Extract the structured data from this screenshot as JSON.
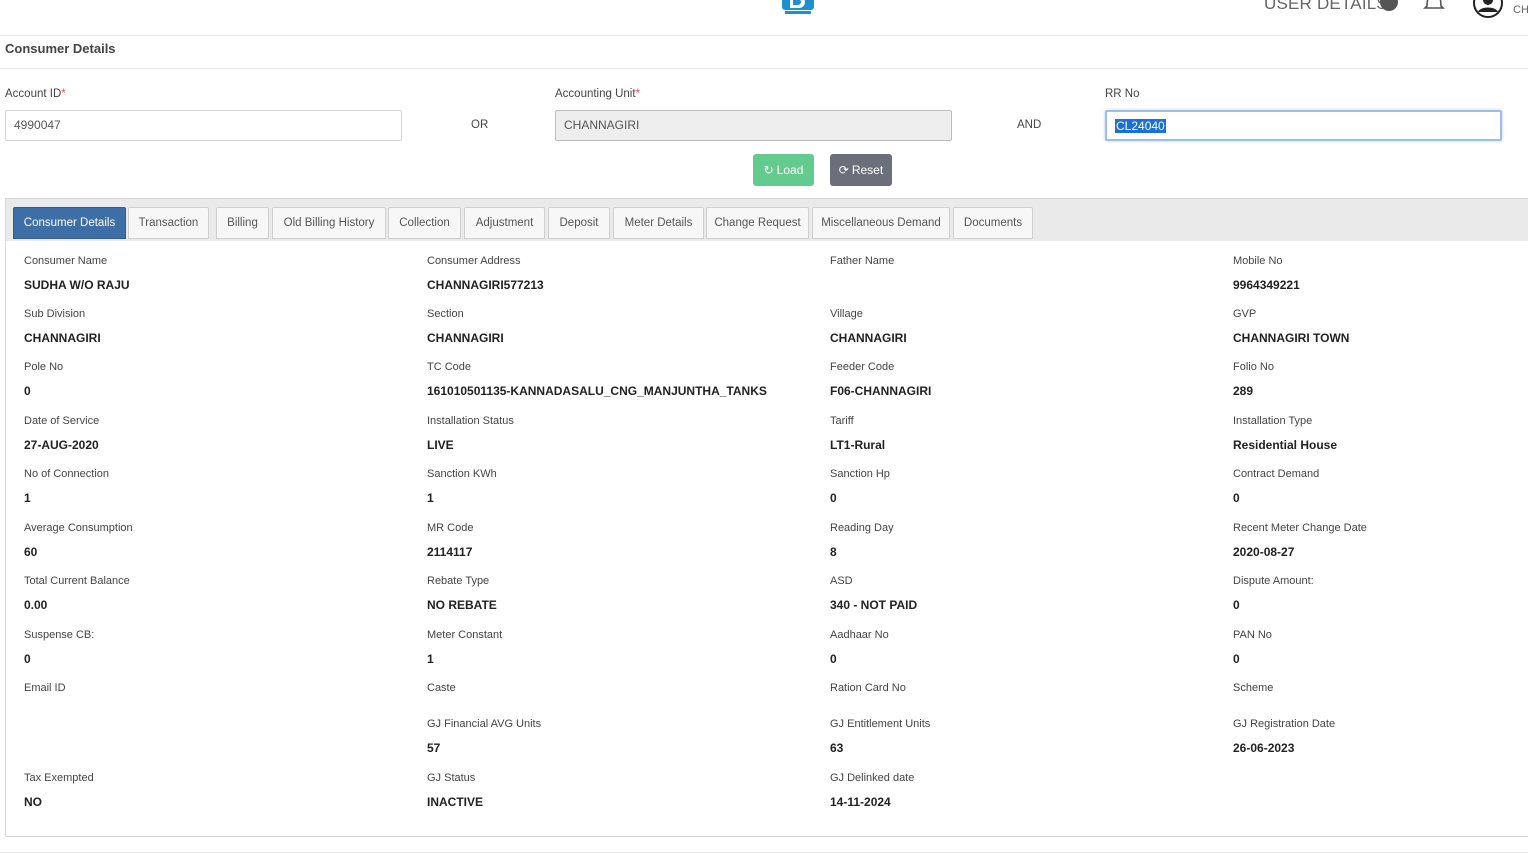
{
  "header": {
    "user_details_label": "USER DETAILS",
    "user_initials_fragment": "CH"
  },
  "page": {
    "title": "Consumer Details"
  },
  "search": {
    "account_id_label": "Account ID",
    "account_id_value": "4990047",
    "or_label": "OR",
    "accounting_unit_label": "Accounting Unit",
    "accounting_unit_value": "CHANNAGIRI",
    "and_label": "AND",
    "rr_no_label": "RR No",
    "rr_no_value": "CL24040",
    "required_mark": "*",
    "load_label": "Load",
    "reset_label": "Reset"
  },
  "tabs": [
    {
      "label": "Consumer Details",
      "active": true
    },
    {
      "label": "Transaction",
      "active": false
    },
    {
      "label": "Billing",
      "active": false
    },
    {
      "label": "Old Billing History",
      "active": false
    },
    {
      "label": "Collection",
      "active": false
    },
    {
      "label": "Adjustment",
      "active": false
    },
    {
      "label": "Deposit",
      "active": false
    },
    {
      "label": "Meter Details",
      "active": false
    },
    {
      "label": "Change Request",
      "active": false
    },
    {
      "label": "Miscellaneous Demand",
      "active": false
    },
    {
      "label": "Documents",
      "active": false
    }
  ],
  "fields": [
    {
      "label": "Consumer Name",
      "value": "SUDHA W/O RAJU"
    },
    {
      "label": "Consumer Address",
      "value": "CHANNAGIRI577213"
    },
    {
      "label": "Father Name",
      "value": ""
    },
    {
      "label": "Mobile No",
      "value": "9964349221"
    },
    {
      "label": "Sub Division",
      "value": "CHANNAGIRI"
    },
    {
      "label": "Section",
      "value": "CHANNAGIRI"
    },
    {
      "label": "Village",
      "value": "CHANNAGIRI"
    },
    {
      "label": "GVP",
      "value": "CHANNAGIRI TOWN"
    },
    {
      "label": "Pole No",
      "value": "0"
    },
    {
      "label": "TC Code",
      "value": "161010501135-KANNADASALU_CNG_MANJUNTHA_TANKS"
    },
    {
      "label": "Feeder Code",
      "value": "F06-CHANNAGIRI"
    },
    {
      "label": "Folio No",
      "value": "289"
    },
    {
      "label": "Date of Service",
      "value": "27-AUG-2020"
    },
    {
      "label": "Installation Status",
      "value": "LIVE"
    },
    {
      "label": "Tariff",
      "value": "LT1-Rural"
    },
    {
      "label": "Installation Type",
      "value": "Residential House"
    },
    {
      "label": "No of Connection",
      "value": "1"
    },
    {
      "label": "Sanction KWh",
      "value": "1"
    },
    {
      "label": "Sanction Hp",
      "value": "0"
    },
    {
      "label": "Contract Demand",
      "value": "0"
    },
    {
      "label": "Average Consumption",
      "value": "60"
    },
    {
      "label": "MR Code",
      "value": "2114117"
    },
    {
      "label": "Reading Day",
      "value": "8"
    },
    {
      "label": "Recent Meter Change Date",
      "value": "2020-08-27"
    },
    {
      "label": "Total Current Balance",
      "value": "0.00"
    },
    {
      "label": "Rebate Type",
      "value": "NO REBATE"
    },
    {
      "label": "ASD",
      "value": "340 - NOT PAID"
    },
    {
      "label": "Dispute Amount:",
      "value": "0"
    },
    {
      "label": "Suspense CB:",
      "value": "0"
    },
    {
      "label": "Meter Constant",
      "value": "1"
    },
    {
      "label": "Aadhaar No",
      "value": "0"
    },
    {
      "label": "PAN No",
      "value": "0"
    },
    {
      "label": "Email ID",
      "value": ""
    },
    {
      "label": "Caste",
      "value": ""
    },
    {
      "label": "Ration Card No",
      "value": ""
    },
    {
      "label": "Scheme",
      "value": ""
    },
    {
      "label": "",
      "value": ""
    },
    {
      "label": "GJ Financial AVG Units",
      "value": "57"
    },
    {
      "label": "GJ Entitlement Units",
      "value": "63"
    },
    {
      "label": "GJ Registration Date",
      "value": "26-06-2023"
    },
    {
      "label": "Tax Exempted",
      "value": "NO"
    },
    {
      "label": "GJ Status",
      "value": "INACTIVE"
    },
    {
      "label": "GJ Delinked date",
      "value": "14-11-2024"
    },
    {
      "label": "",
      "value": ""
    }
  ],
  "colors": {
    "active_tab": "#3d6ea6",
    "load_button": "#62cb8d",
    "reset_button": "#6a6f79",
    "required_mark": "#d9534f",
    "selection": "#1a6fdc"
  }
}
